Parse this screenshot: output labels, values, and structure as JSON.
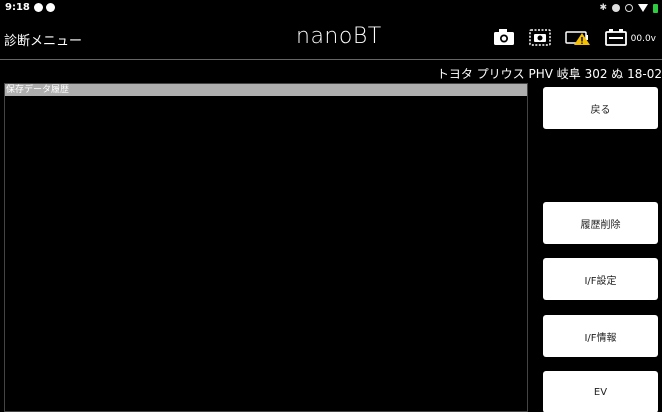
{
  "status_bar": {
    "time": "9:18"
  },
  "header": {
    "title": "診断メニュー",
    "brand": "nanoBT",
    "voltage": "00.0v",
    "icons": [
      "camera-icon",
      "screenshot-camera-icon",
      "battery-warning-icon",
      "battery-icon"
    ]
  },
  "vehicle": {
    "name": "トヨタ プリウス PHV 岐阜 302 ぬ 18-02"
  },
  "history": {
    "header": "保存データ履歴"
  },
  "buttons": {
    "back": "戻る",
    "delete_history": "履歴削除",
    "if_settings": "I/F設定",
    "if_info": "I/F情報",
    "ev": "EV"
  },
  "colors": {
    "background": "#000000",
    "button": "#ffffff",
    "history_header": "#aeaeae",
    "warning": "#f5c000"
  }
}
